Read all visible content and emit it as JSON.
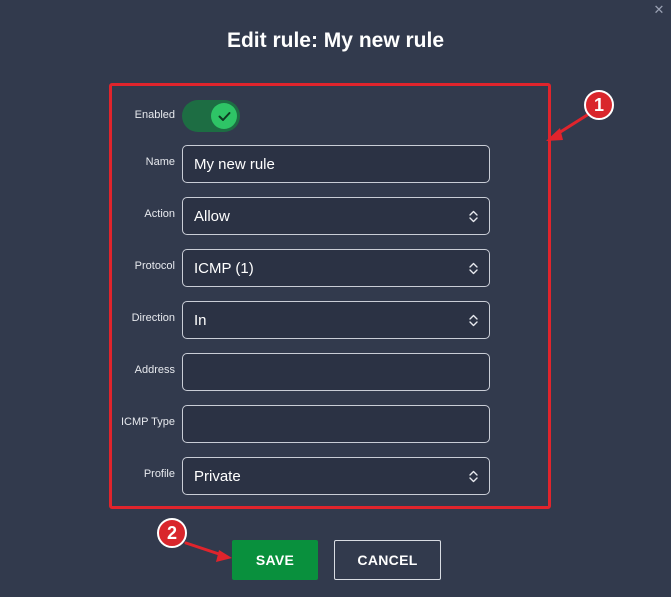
{
  "window": {
    "close_glyph": "✕"
  },
  "dialog": {
    "title": "Edit rule: My new rule"
  },
  "form": {
    "enabled": {
      "label": "Enabled",
      "state": true
    },
    "name": {
      "label": "Name",
      "value": "My new rule"
    },
    "action": {
      "label": "Action",
      "value": "Allow"
    },
    "protocol": {
      "label": "Protocol",
      "value": "ICMP (1)"
    },
    "direction": {
      "label": "Direction",
      "value": "In"
    },
    "address": {
      "label": "Address",
      "value": ""
    },
    "icmp_type": {
      "label": "ICMP Type",
      "value": ""
    },
    "profile": {
      "label": "Profile",
      "value": "Private"
    }
  },
  "buttons": {
    "save": "SAVE",
    "cancel": "CANCEL"
  },
  "annotations": {
    "marker1": "1",
    "marker2": "2"
  },
  "colors": {
    "background": "#323a4d",
    "highlight_border": "#e0242c",
    "toggle_on": "#2ec466",
    "save_button": "#09903d",
    "badge": "#d9262c"
  }
}
